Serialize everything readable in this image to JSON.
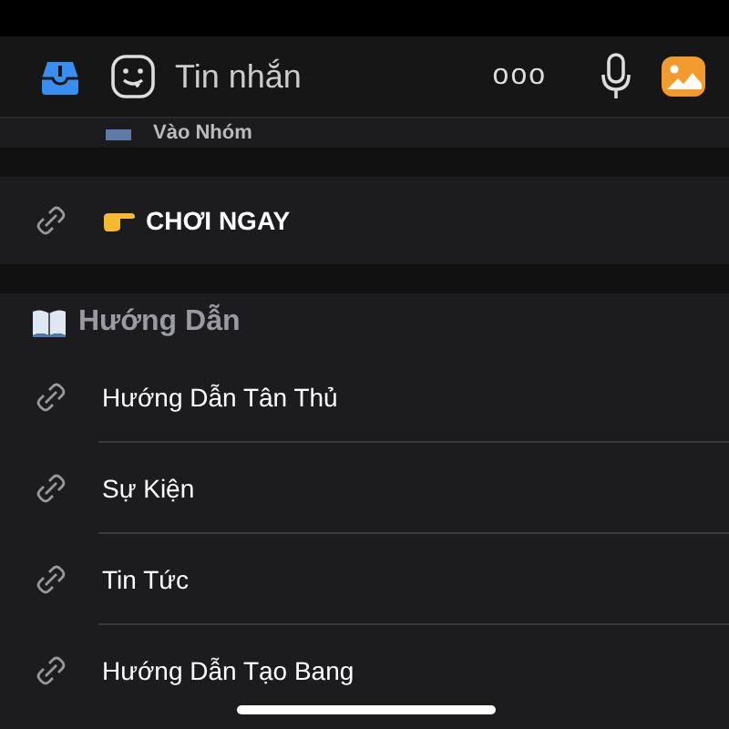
{
  "header": {
    "title": "Tin nhắn",
    "more": "ooo"
  },
  "top_row": {
    "label": "Vào Nhóm"
  },
  "featured": {
    "label": "CHƠI NGAY"
  },
  "section": {
    "title": "Hướng Dẫn",
    "items": [
      {
        "label": "Hướng Dẫn Tân Thủ"
      },
      {
        "label": "Sự Kiện"
      },
      {
        "label": "Tin Tức"
      },
      {
        "label": "Hướng Dẫn Tạo Bang"
      }
    ]
  }
}
